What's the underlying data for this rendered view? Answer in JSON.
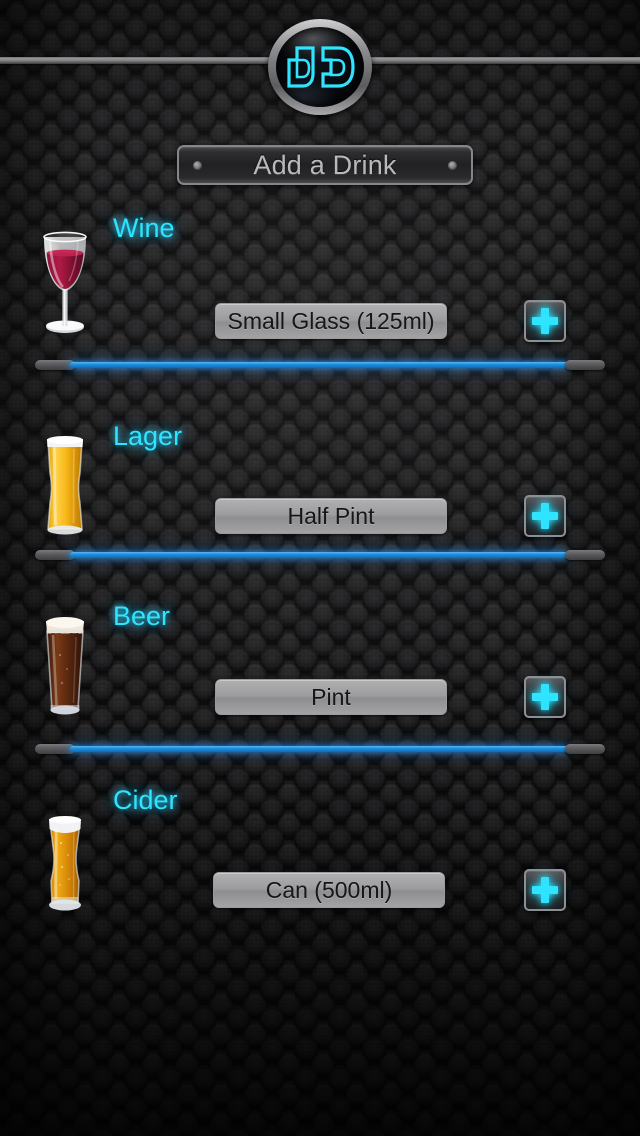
{
  "app": {
    "logo_text": "DD",
    "logo_name": "dd-logo"
  },
  "header": {
    "title": "Add a Drink",
    "left_dot": "rivet-dot",
    "right_dot": "rivet-dot"
  },
  "theme": {
    "accent_cyan": "#2fe4ff",
    "divider_blue": "#1f8fe0",
    "plate_text": "#b9b9bb",
    "select_bg": "#9d9da0",
    "select_text": "#16161a",
    "background": "#161617"
  },
  "drinks": [
    {
      "name": "Wine",
      "icon": "wine-glass-icon",
      "size_value": "Small Glass (125ml)",
      "add_label": "+",
      "add_icon": "plus-icon",
      "divider": true
    },
    {
      "name": "Lager",
      "icon": "lager-glass-icon",
      "size_value": "Half Pint",
      "add_label": "+",
      "add_icon": "plus-icon",
      "divider": true
    },
    {
      "name": "Beer",
      "icon": "beer-glass-icon",
      "size_value": "Pint",
      "add_label": "+",
      "add_icon": "plus-icon",
      "divider": true
    },
    {
      "name": "Cider",
      "icon": "cider-glass-icon",
      "size_value": "Can (500ml)",
      "add_label": "+",
      "add_icon": "plus-icon",
      "divider": false
    }
  ]
}
